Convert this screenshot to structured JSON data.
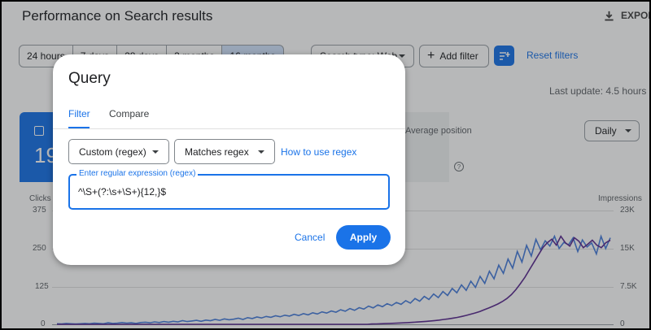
{
  "page": {
    "title": "Performance on Search results",
    "export_label": "EXPORT",
    "date_chips": [
      "24 hours",
      "7 days",
      "28 days",
      "3 months",
      "16 months"
    ],
    "search_type": "Search type: Web",
    "add_filter": "Add filter",
    "reset_filters": "Reset filters",
    "last_update": "Last update: 4.5 hours ago",
    "clicks_card_value": "19",
    "position_card_label": "Average position",
    "granularity": "Daily",
    "left_axis_title": "Clicks",
    "right_axis_title": "Impressions",
    "left_ticks": [
      "375",
      "250",
      "125",
      "0"
    ],
    "right_ticks": [
      "23K",
      "15K",
      "7.5K",
      "0"
    ]
  },
  "dialog": {
    "title": "Query",
    "tabs": [
      "Filter",
      "Compare"
    ],
    "active_tab": "Filter",
    "filter_type": "Custom (regex)",
    "match_type": "Matches regex",
    "help_link": "How to use regex",
    "regex_label": "Enter regular expression (regex)",
    "regex_value": "^\\S+(?:\\s+\\S+){12,}$",
    "cancel_label": "Cancel",
    "apply_label": "Apply"
  },
  "colors": {
    "accent": "#1a73e8",
    "clicks_line": "#4a7fdc",
    "impressions_line": "#5c2d91"
  },
  "chart_data": {
    "type": "line",
    "x_count": 120,
    "series": [
      {
        "name": "Clicks",
        "axis": "left",
        "values": [
          2,
          1,
          3,
          2,
          1,
          2,
          3,
          2,
          4,
          3,
          2,
          5,
          3,
          4,
          6,
          4,
          5,
          3,
          6,
          7,
          5,
          8,
          6,
          9,
          7,
          10,
          8,
          12,
          9,
          11,
          13,
          10,
          14,
          12,
          16,
          13,
          18,
          15,
          17,
          20,
          16,
          22,
          19,
          24,
          21,
          26,
          23,
          28,
          25,
          30,
          27,
          33,
          29,
          35,
          31,
          38,
          34,
          41,
          37,
          44,
          40,
          48,
          43,
          52,
          46,
          55,
          50,
          60,
          54,
          64,
          58,
          68,
          62,
          72,
          66,
          78,
          70,
          85,
          76,
          92,
          82,
          100,
          88,
          108,
          95,
          118,
          104,
          130,
          112,
          142,
          122,
          158,
          135,
          175,
          150,
          195,
          168,
          215,
          185,
          240,
          205,
          260,
          225,
          280,
          246,
          275,
          258,
          290,
          250,
          270,
          262,
          285,
          240,
          278,
          255,
          268,
          232,
          290,
          250,
          285
        ]
      },
      {
        "name": "Impressions",
        "axis": "right",
        "values": [
          0,
          0,
          0,
          0,
          0,
          0,
          0,
          0,
          0,
          0,
          0,
          0,
          0,
          0,
          0,
          0,
          0,
          0,
          0,
          0,
          0,
          0,
          0,
          0,
          0,
          0,
          0,
          0,
          0,
          0,
          0,
          0,
          0,
          0,
          0,
          0,
          0,
          0,
          0,
          0,
          0,
          0,
          0,
          0,
          0,
          0,
          0,
          0,
          0,
          0,
          0,
          0,
          0,
          0,
          0,
          0,
          0,
          0,
          0,
          0,
          0,
          0,
          0,
          0,
          0,
          0,
          0,
          0,
          0,
          0,
          60,
          90,
          120,
          150,
          180,
          220,
          260,
          300,
          350,
          400,
          460,
          520,
          590,
          670,
          760,
          860,
          980,
          1100,
          1250,
          1400,
          1600,
          1800,
          2050,
          2300,
          2600,
          2950,
          3300,
          3700,
          4100,
          4600,
          5200,
          6000,
          7000,
          8200,
          9500,
          11000,
          12500,
          14000,
          15500,
          16500,
          17200,
          16000,
          17800,
          16500,
          15800,
          17500,
          16800,
          15500,
          16200,
          17000,
          16000,
          15500,
          16500,
          17000
        ]
      }
    ],
    "left_ylim": [
      0,
      375
    ],
    "right_ylim": [
      0,
      23000
    ]
  }
}
